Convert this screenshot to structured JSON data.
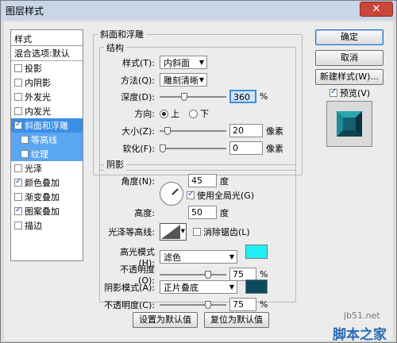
{
  "window": {
    "title": "图层样式",
    "close": "✕"
  },
  "style_list": {
    "header": "样式",
    "blend_default": "混合选项:默认",
    "items": [
      {
        "label": "投影",
        "checked": false
      },
      {
        "label": "内阴影",
        "checked": false
      },
      {
        "label": "外发光",
        "checked": false
      },
      {
        "label": "内发光",
        "checked": false
      },
      {
        "label": "斜面和浮雕",
        "checked": true,
        "selected": true
      },
      {
        "label": "等高线",
        "checked": false,
        "sub": true
      },
      {
        "label": "纹理",
        "checked": false,
        "sub": true
      },
      {
        "label": "光泽",
        "checked": false
      },
      {
        "label": "颜色叠加",
        "checked": true
      },
      {
        "label": "渐变叠加",
        "checked": false
      },
      {
        "label": "图案叠加",
        "checked": true
      },
      {
        "label": "描边",
        "checked": false
      }
    ]
  },
  "bevel": {
    "section_title": "斜面和浮雕",
    "structure_title": "结构",
    "style_label": "样式(T):",
    "style_value": "内斜面",
    "method_label": "方法(Q):",
    "method_value": "雕刻清晰",
    "depth_label": "深度(D):",
    "depth_value": "360",
    "depth_unit": "%",
    "depth_slider": 0.36,
    "direction_label": "方向:",
    "direction_up": "上",
    "direction_down": "下",
    "size_label": "大小(Z):",
    "size_value": "20",
    "size_unit": "像素",
    "size_slider": 0.08,
    "soften_label": "软化(F):",
    "soften_value": "0",
    "soften_unit": "像素",
    "soften_slider": 0.0
  },
  "shading": {
    "title": "阴影",
    "angle_label": "角度(N):",
    "angle_value": "45",
    "angle_unit": "度",
    "global_light": "使用全局光(G)",
    "altitude_label": "高度:",
    "altitude_value": "50",
    "altitude_unit": "度",
    "gloss_label": "光泽等高线:",
    "antialias": "消除锯齿(L)",
    "highlight_label": "高光模式(H):",
    "highlight_mode": "滤色",
    "highlight_color": "#1ef0f5",
    "highlight_opacity_label": "不透明度(O):",
    "highlight_opacity": "75",
    "highlight_opacity_unit": "%",
    "highlight_opacity_slider": 0.75,
    "shadow_label": "阴影模式(A):",
    "shadow_mode": "正片叠底",
    "shadow_color": "#0e4a5e",
    "shadow_opacity_label": "不透明度(C):",
    "shadow_opacity": "75",
    "shadow_opacity_unit": "%",
    "shadow_opacity_slider": 0.75
  },
  "footer": {
    "set_default": "设置为默认值",
    "reset_default": "复位为默认值"
  },
  "right_panel": {
    "ok": "确定",
    "cancel": "取消",
    "new_style": "新建样式(W)...",
    "preview": "预览(V)"
  },
  "watermark": {
    "site": "jb51.net",
    "brand": "脚本之家"
  }
}
